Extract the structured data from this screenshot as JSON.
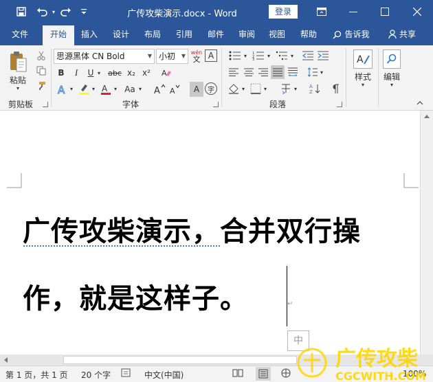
{
  "titlebar": {
    "doc_title": "广传攻柴演示.docx  -  Word",
    "login_label": "登录"
  },
  "tabs": [
    {
      "label": "文件"
    },
    {
      "label": "开始"
    },
    {
      "label": "插入"
    },
    {
      "label": "设计"
    },
    {
      "label": "布局"
    },
    {
      "label": "引用"
    },
    {
      "label": "邮件"
    },
    {
      "label": "审阅"
    },
    {
      "label": "视图"
    },
    {
      "label": "帮助"
    }
  ],
  "tell_me": "告诉我",
  "share": "共享",
  "ribbon": {
    "clipboard": {
      "paste_label": "粘贴",
      "group_label": "剪贴板"
    },
    "font": {
      "font_name": "思源黑体 CN Bold",
      "font_size": "小初",
      "wen_label": "wén",
      "wen_char": "文",
      "group_label": "字体",
      "bold": "B",
      "italic": "I",
      "underline": "U",
      "strike": "abc",
      "sub": "x₂",
      "sup": "x²",
      "aa_label": "Aa",
      "grow_label": "A",
      "shrink_label": "A",
      "char_shade": "A",
      "enclose": "字"
    },
    "paragraph": {
      "group_label": "段落"
    },
    "styles": {
      "label": "样式"
    },
    "editing": {
      "label": "编辑"
    }
  },
  "document": {
    "line1": "广传攻柴演示，合并双行操",
    "line2": "作，就是这样子。",
    "paragraph_mark": "↵",
    "ime_char": "中"
  },
  "statusbar": {
    "page": "第 1 页，共 1 页",
    "words": "20 个字",
    "language": "中文(中国)",
    "zoom": "100%"
  },
  "watermark": {
    "cn": "广传攻柴",
    "en": "CGCWITH.COM"
  },
  "colors": {
    "brand": "#2b579a",
    "highlight": "#ffff00",
    "font_color": "#e02020"
  }
}
